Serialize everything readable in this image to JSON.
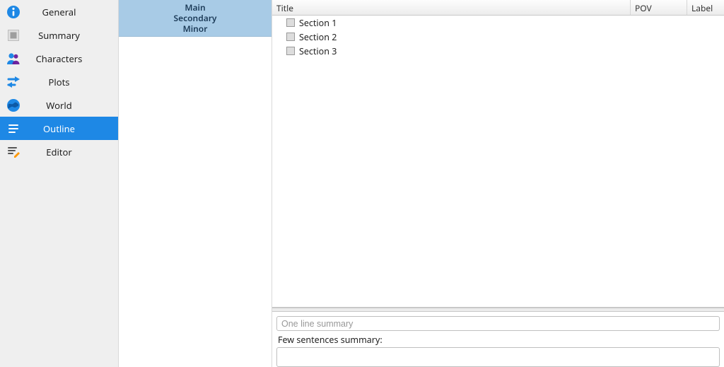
{
  "nav": {
    "items": [
      {
        "label": "General"
      },
      {
        "label": "Summary"
      },
      {
        "label": "Characters"
      },
      {
        "label": "Plots"
      },
      {
        "label": "World"
      },
      {
        "label": "Outline"
      },
      {
        "label": "Editor"
      }
    ],
    "selected_index": 5
  },
  "categories": {
    "lines": [
      "Main",
      "Secondary",
      "Minor"
    ]
  },
  "tree": {
    "columns": {
      "title": "Title",
      "pov": "POV",
      "label": "Label"
    },
    "rows": [
      "Section 1",
      "Section 2",
      "Section 3"
    ]
  },
  "summary": {
    "one_line_placeholder": "One line summary",
    "few_label": "Few sentences summary:"
  },
  "colors": {
    "accent": "#1e88e5",
    "category_bg": "#a8cbe6"
  }
}
